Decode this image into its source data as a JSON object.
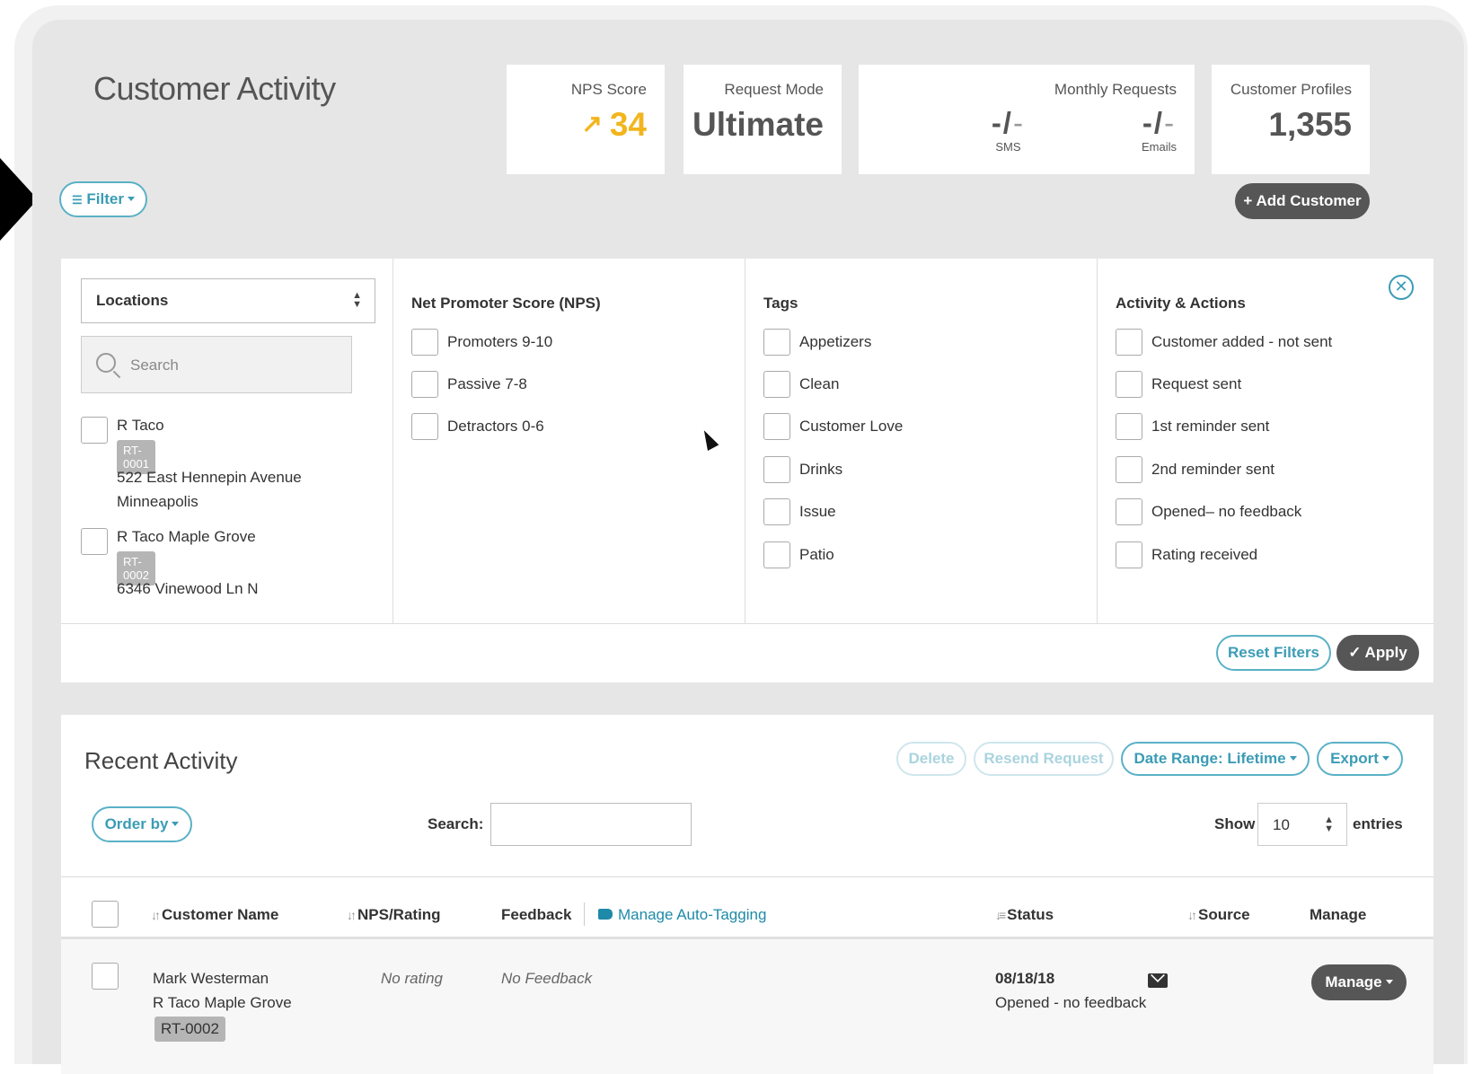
{
  "page": {
    "title": "Customer Activity"
  },
  "stats": {
    "nps": {
      "label": "NPS Score",
      "value": "34"
    },
    "request_mode": {
      "label": "Request Mode",
      "value": "Ultimate"
    },
    "monthly_requests": {
      "label": "Monthly Requests",
      "sms": {
        "dash": "-/",
        "dim": "-",
        "sub": "SMS"
      },
      "emails": {
        "dash": "-/",
        "dim": "-",
        "sub": "Emails"
      }
    },
    "profiles": {
      "label": "Customer Profiles",
      "value": "1,355"
    }
  },
  "toolbar": {
    "filter_label": "Filter",
    "add_customer_label": "+ Add Customer"
  },
  "filters": {
    "locations": {
      "select_label": "Locations",
      "search_placeholder": "Search",
      "items": [
        {
          "name": "R Taco",
          "code": "RT-0001",
          "address_1": "522 East Hennepin Avenue",
          "address_2": "Minneapolis"
        },
        {
          "name": "R Taco Maple Grove",
          "code": "RT-0002",
          "address_1": "6346 Vinewood Ln N"
        }
      ]
    },
    "nps": {
      "title": "Net Promoter Score (NPS)",
      "options": [
        "Promoters 9-10",
        "Passive 7-8",
        "Detractors 0-6"
      ]
    },
    "tags": {
      "title": "Tags",
      "options": [
        "Appetizers",
        "Clean",
        "Customer Love",
        "Drinks",
        "Issue",
        "Patio"
      ]
    },
    "activity": {
      "title": "Activity & Actions",
      "options": [
        "Customer added - not sent",
        "Request sent",
        "1st reminder sent",
        "2nd reminder sent",
        "Opened– no feedback",
        "Rating received"
      ]
    },
    "reset_label": "Reset Filters",
    "apply_label": "✓ Apply"
  },
  "recent": {
    "title": "Recent Activity",
    "delete_label": "Delete",
    "resend_label": "Resend Request",
    "date_range_label": "Date Range: Lifetime",
    "export_label": "Export",
    "order_by_label": "Order by",
    "search_label": "Search:",
    "show_label": "Show",
    "show_value": "10",
    "entries_label": "entries",
    "columns": {
      "customer_name": "Customer Name",
      "nps_rating": "NPS/Rating",
      "feedback": "Feedback",
      "manage_auto_tagging": "Manage Auto-Tagging",
      "status": "Status",
      "source": "Source",
      "manage": "Manage"
    },
    "rows": [
      {
        "customer_name": "Mark Westerman",
        "location": "R Taco Maple Grove",
        "code": "RT-0002",
        "rating": "No rating",
        "feedback": "No Feedback",
        "status_date": "08/18/18",
        "status_text": "Opened - no feedback",
        "source_icon": "envelope-icon",
        "manage_label": "Manage"
      }
    ]
  },
  "colors": {
    "accent": "#3b9cb5",
    "nps": "#f2b51d",
    "dark_button": "#565656"
  }
}
